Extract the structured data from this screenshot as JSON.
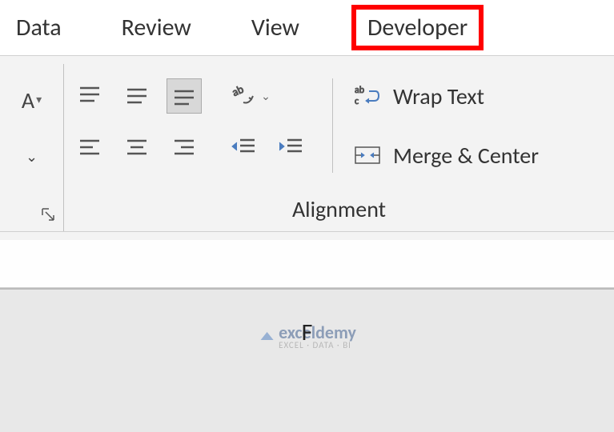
{
  "tabs": {
    "data": "Data",
    "review": "Review",
    "view": "View",
    "developer": "Developer"
  },
  "alignment": {
    "wrap_label": "Wrap Text",
    "merge_label": "Merge & Center",
    "group_label": "Alignment"
  },
  "sheet": {
    "column_label": "F"
  },
  "watermark": {
    "brand": "exceldemy",
    "tagline": "EXCEL · DATA · BI"
  }
}
